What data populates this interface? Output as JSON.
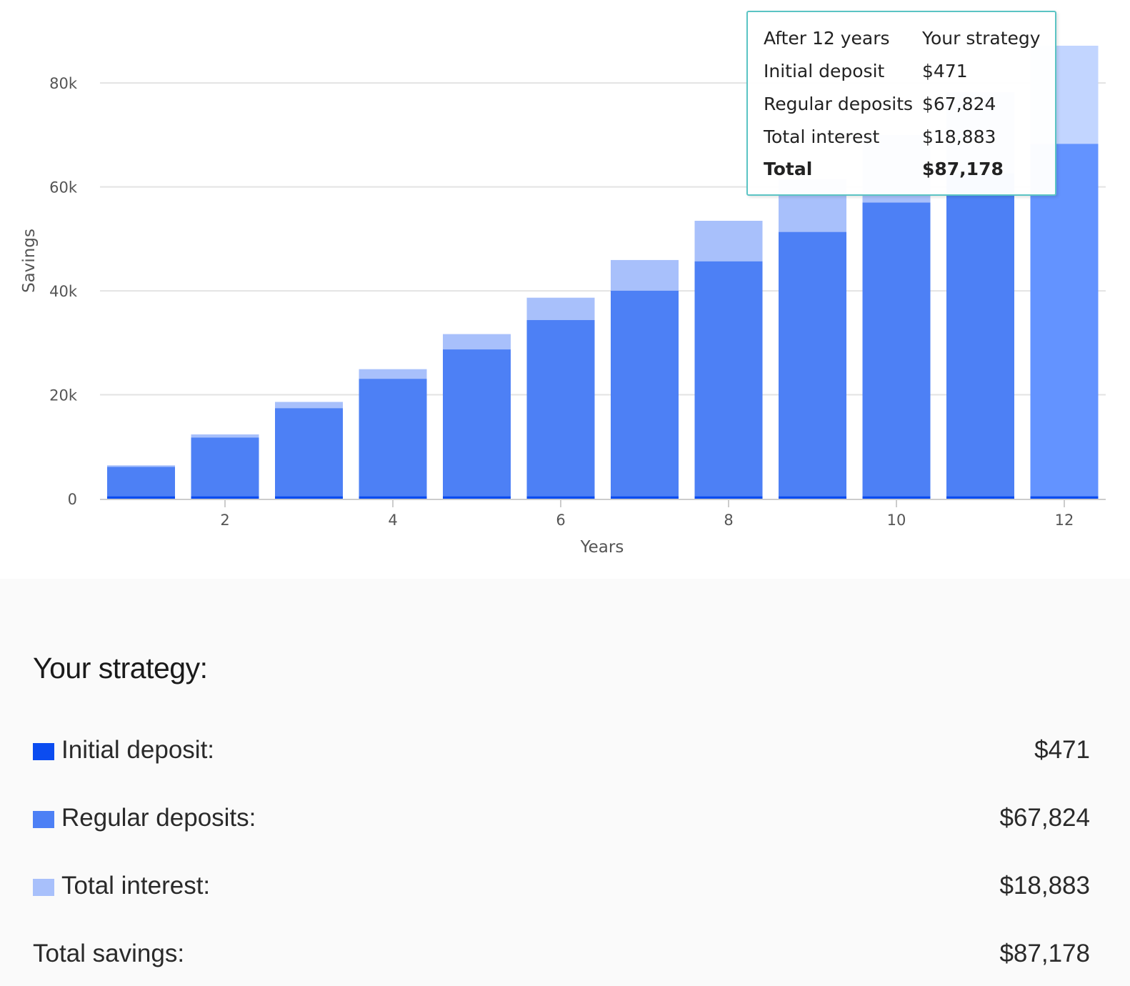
{
  "colors": {
    "initial": "#0b4cf0",
    "regular": "#4d80f5",
    "interest": "#a8c0fb",
    "regular_highlight": "#6393ff",
    "interest_highlight": "#c2d5ff",
    "grid": "#e3e3e3",
    "axis_text": "#555555"
  },
  "chart_data": {
    "type": "bar",
    "stacked": true,
    "x": [
      1,
      2,
      3,
      4,
      5,
      6,
      7,
      8,
      9,
      10,
      11,
      12
    ],
    "x_ticks": [
      2,
      4,
      6,
      8,
      10,
      12
    ],
    "y_ticks": [
      {
        "value": 0,
        "label": "0"
      },
      {
        "value": 20000,
        "label": "20k"
      },
      {
        "value": 40000,
        "label": "40k"
      },
      {
        "value": 60000,
        "label": "60k"
      },
      {
        "value": 80000,
        "label": "80k"
      }
    ],
    "ylim": [
      0,
      88000
    ],
    "xlabel": "Years",
    "ylabel": "Savings",
    "grid": true,
    "highlighted_index": 11,
    "series": [
      {
        "name": "Initial deposit",
        "values": [
          471,
          471,
          471,
          471,
          471,
          471,
          471,
          471,
          471,
          471,
          471,
          471
        ]
      },
      {
        "name": "Regular deposits",
        "values": [
          5652,
          11304,
          16956,
          22608,
          28260,
          33912,
          39564,
          45216,
          50868,
          56520,
          62172,
          67824
        ]
      },
      {
        "name": "Total interest",
        "values": [
          300,
          600,
          1200,
          1850,
          2950,
          4300,
          5900,
          7800,
          10200,
          13000,
          15600,
          18883
        ]
      }
    ]
  },
  "tooltip": {
    "header_left": "After 12 years",
    "header_right": "Your strategy",
    "rows": [
      {
        "label": "Initial deposit",
        "value": "$471"
      },
      {
        "label": "Regular deposits",
        "value": "$67,824"
      },
      {
        "label": "Total interest",
        "value": "$18,883"
      }
    ],
    "total_label": "Total",
    "total_value": "$87,178"
  },
  "summary": {
    "title": "Your strategy:",
    "rows": [
      {
        "label": "Initial deposit:",
        "value": "$471"
      },
      {
        "label": "Regular deposits:",
        "value": "$67,824"
      },
      {
        "label": "Total interest:",
        "value": "$18,883"
      }
    ],
    "total_label": "Total savings:",
    "total_value": "$87,178"
  }
}
